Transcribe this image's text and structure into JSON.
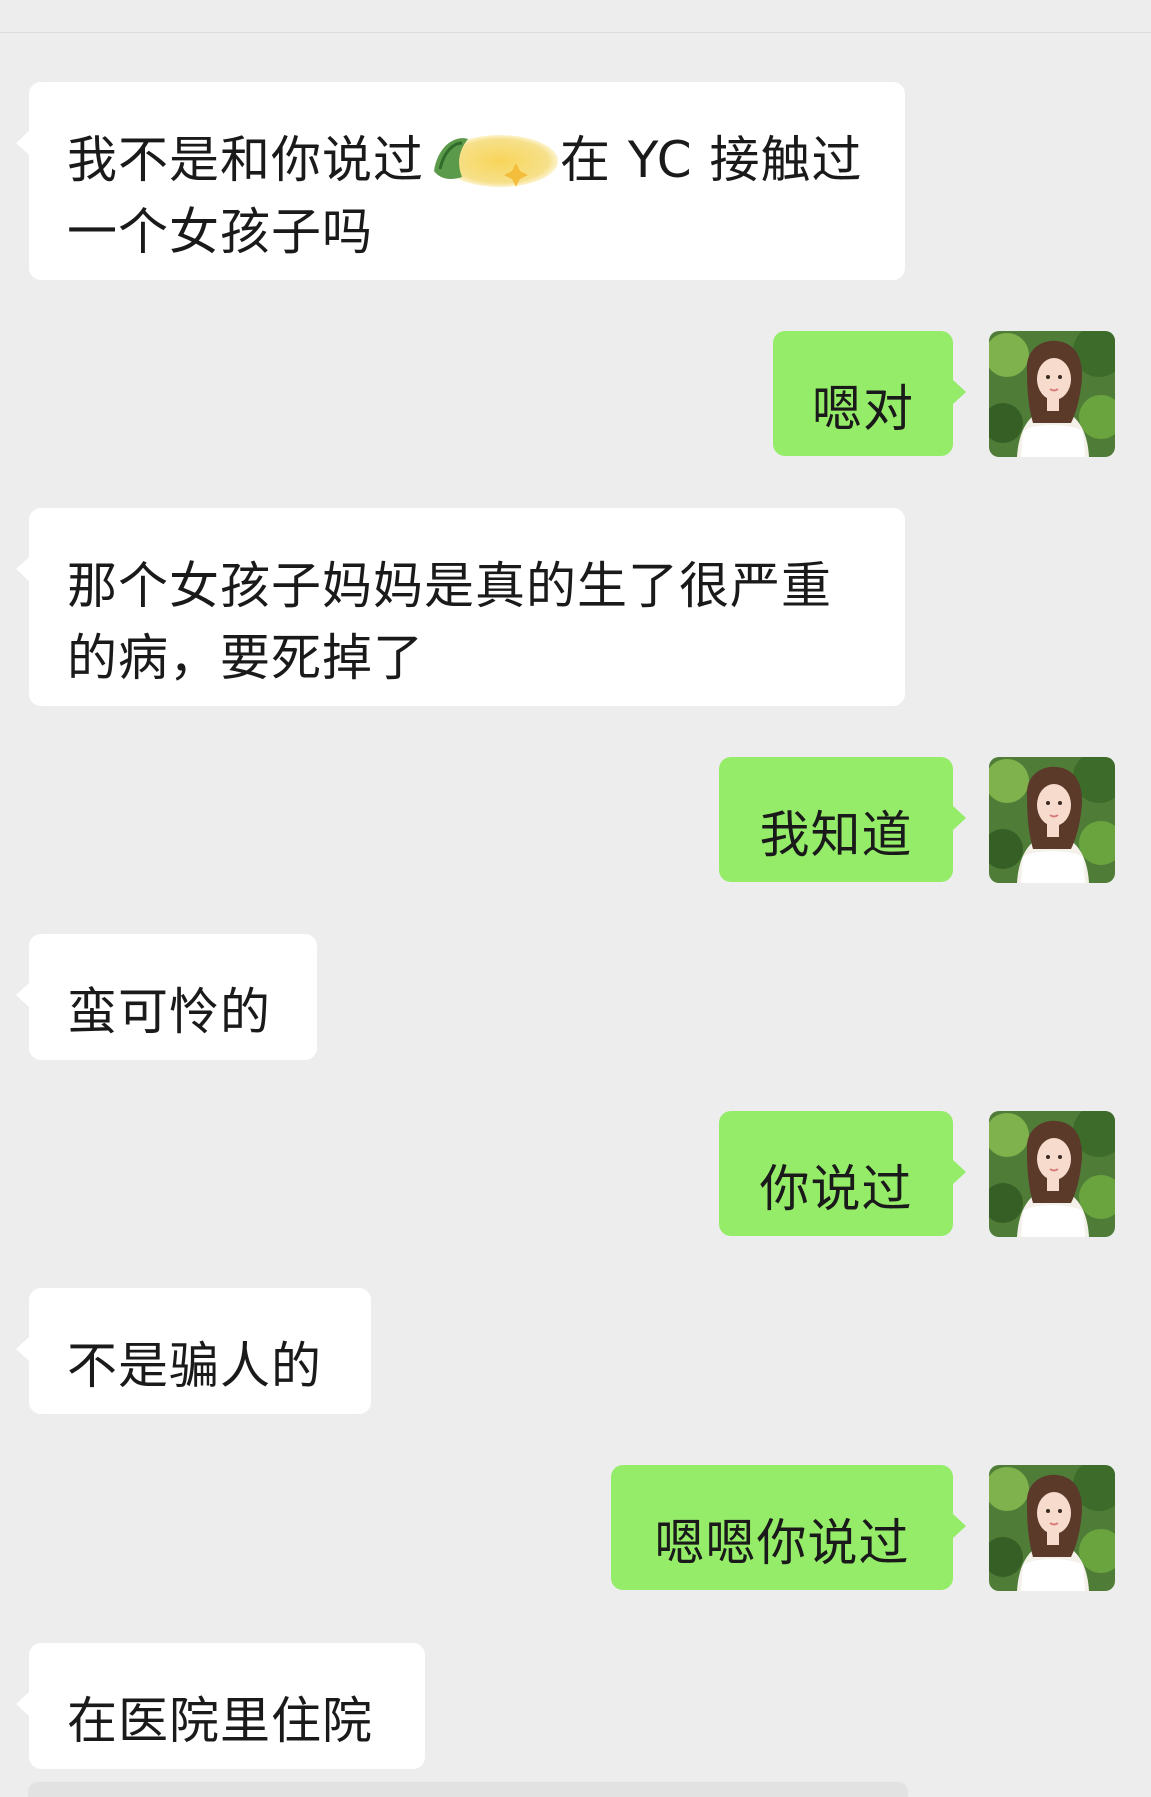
{
  "messages": [
    {
      "side": "received",
      "text_before": "我不是和你说过",
      "sticker": "blurred-sticker-icon",
      "text_after": "在 YC 接触过一个女孩子吗"
    },
    {
      "side": "sent",
      "text": "嗯对"
    },
    {
      "side": "received",
      "text": "那个女孩子妈妈是真的生了很严重的病，要死掉了"
    },
    {
      "side": "sent",
      "text": "我知道"
    },
    {
      "side": "received",
      "text": "蛮可怜的"
    },
    {
      "side": "sent",
      "text": "你说过"
    },
    {
      "side": "received",
      "text": "不是骗人的"
    },
    {
      "side": "sent",
      "text": "嗯嗯你说过"
    },
    {
      "side": "received",
      "text": "在医院里住院"
    }
  ],
  "colors": {
    "background": "#ededed",
    "received_bubble": "#ffffff",
    "sent_bubble": "#95ec69",
    "text": "#1a1a1a"
  },
  "avatar": {
    "icon": "user-avatar-icon"
  }
}
